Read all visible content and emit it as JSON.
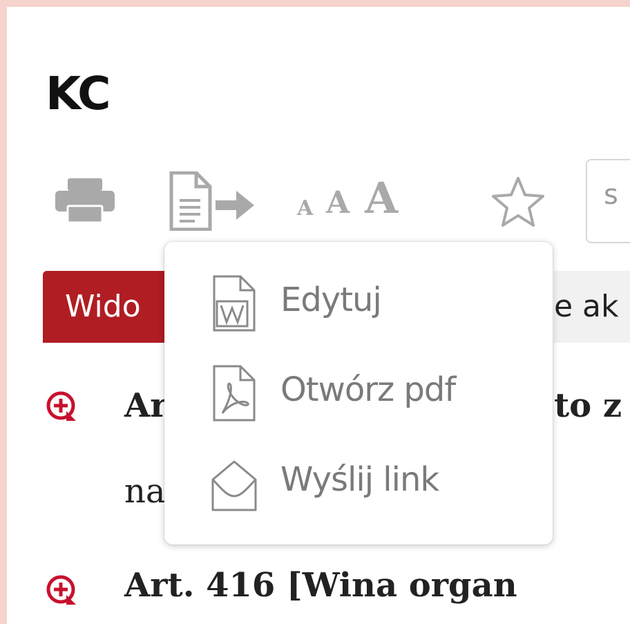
{
  "document": {
    "title": "KC"
  },
  "toolbar": {
    "print_icon": "printer-icon",
    "export_icon": "document-export-icon",
    "font_size_labels": [
      "A",
      "A",
      "A"
    ],
    "star_icon": "star-outline-icon",
    "search_value": "s"
  },
  "tabs": {
    "active_label": "Wido",
    "other_label": "e ak"
  },
  "articles": [
    {
      "prefix": "Ar",
      "suffix": "to z",
      "line2": "na"
    },
    {
      "text": "Art. 416 [Wina organ"
    }
  ],
  "dropdown": {
    "items": [
      {
        "icon": "word-file-icon",
        "label": "Edytuj"
      },
      {
        "icon": "pdf-file-icon",
        "label": "Otwórz pdf"
      },
      {
        "icon": "envelope-open-icon",
        "label": "Wyślij link"
      }
    ]
  },
  "colors": {
    "accent": "#b01d23",
    "border": "#f7d3cd",
    "icon_gray": "#a9a9a9",
    "menu_text": "#7a7a7a"
  }
}
